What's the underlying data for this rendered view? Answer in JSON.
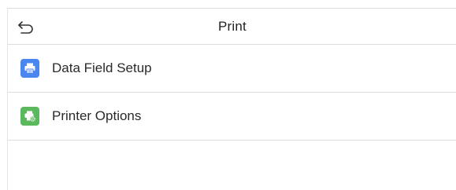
{
  "header": {
    "title": "Print",
    "back_icon": "back-arrow-icon"
  },
  "menu": [
    {
      "label": "Data Field Setup",
      "icon": "printer-document-icon",
      "icon_color": "#4a86f0"
    },
    {
      "label": "Printer Options",
      "icon": "printer-gear-icon",
      "icon_color": "#5cb85c"
    }
  ],
  "colors": {
    "divider": "#dcdcdc",
    "background": "#ffffff",
    "text": "#222222"
  }
}
